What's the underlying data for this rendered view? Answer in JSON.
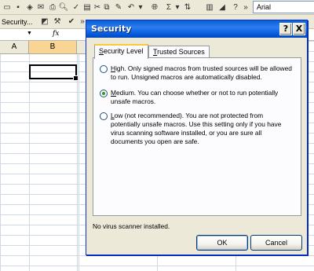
{
  "excel": {
    "toolbar_security_label": "Security...",
    "font_name": "Arial",
    "formula_fx": "fx",
    "columns": [
      "A",
      "B"
    ],
    "icons": [
      "print-icon",
      "print-preview-icon",
      "spelling-icon",
      "research-icon",
      "cut-icon",
      "copy-icon",
      "paste-icon",
      "format-painter-icon",
      "undo-icon",
      "hyperlink-icon",
      "autosum-icon",
      "sort-icon",
      "chart-wizard-icon",
      "help-icon",
      "design-mode-icon",
      "tools-icon",
      "script-editor-icon"
    ]
  },
  "dialog": {
    "title": "Security",
    "help_glyph": "?",
    "close_glyph": "X",
    "tabs": [
      {
        "access": "S",
        "rest": "ecurity Level"
      },
      {
        "access": "T",
        "rest": "rusted Sources"
      }
    ],
    "options": [
      {
        "access": "H",
        "rest": "igh. Only signed macros from trusted sources will be allowed to run. Unsigned macros are automatically disabled.",
        "checked": false
      },
      {
        "access": "M",
        "rest": "edium. You can choose whether or not to run potentially unsafe macros.",
        "checked": true
      },
      {
        "access": "L",
        "rest": "ow (not recommended). You are not protected from potentially unsafe macros. Use this setting only if you have virus scanning software installed, or you are sure all documents you open are safe.",
        "checked": false
      }
    ],
    "status": "No virus scanner installed.",
    "ok_label": "OK",
    "cancel_label": "Cancel"
  }
}
